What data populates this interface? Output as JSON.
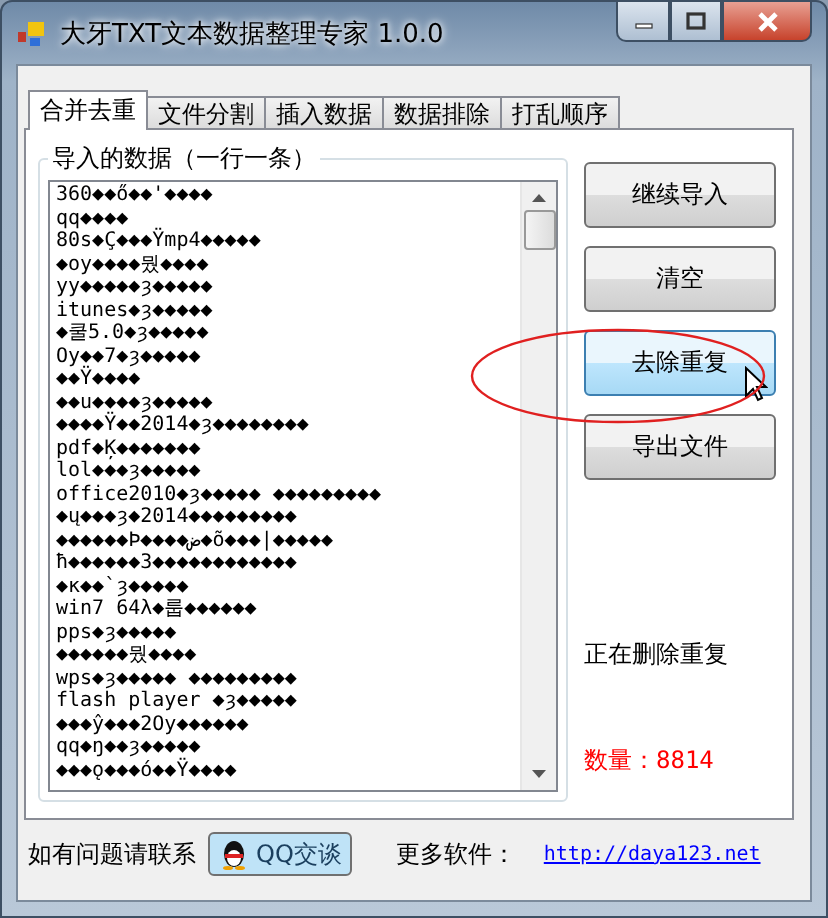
{
  "window": {
    "title": "大牙TXT文本数据整理专家 1.0.0"
  },
  "tabs": [
    {
      "label": "合并去重",
      "selected": true
    },
    {
      "label": "文件分割",
      "selected": false
    },
    {
      "label": "插入数据",
      "selected": false
    },
    {
      "label": "数据排除",
      "selected": false
    },
    {
      "label": "打乱顺序",
      "selected": false
    }
  ],
  "group": {
    "title": "导入的数据（一行一条）",
    "lines": [
      "360◆◆ő◆◆'◆◆◆◆",
      "qq◆◆◆◆",
      "80s◆Ç◆◆◆Ÿmp4◆◆◆◆◆",
      "◆oy◆◆◆◆뭤◆◆◆◆",
      "yy◆◆◆◆◆ȝ◆◆◆◆◆",
      "itunes◆ȝ◆◆◆◆◆",
      "◆쿨5.0◆ȝ◆◆◆◆◆",
      "Oy◆◆7◆ȝ◆◆◆◆◆",
      "◆◆Ÿ◆◆◆◆",
      "◆◆u◆◆◆◆ȝ◆◆◆◆◆",
      "◆◆◆◆Ÿ◆◆2014◆ȝ◆◆◆◆◆◆◆◆",
      "pdf◆Ķ◆◆◆◆◆◆◆",
      "lol◆◆◆ȝ◆◆◆◆◆",
      "office2010◆ȝ◆◆◆◆◆ ◆◆◆◆◆◆◆◆◆",
      "◆ų◆◆◆ȝ◆2014◆◆◆◆◆◆◆◆◆",
      "◆◆◆◆◆◆Þ◆◆◆◆ض◆õ◆◆◆|◆◆◆◆◆",
      "ħ◆◆◆◆◆◆3◆◆◆◆◆◆◆◆◆◆◆◆",
      "◆ĸ◆◆`ȝ◆◆◆◆◆",
      "win7 64λ◆룹◆◆◆◆◆◆",
      "pps◆ȝ◆◆◆◆◆",
      "◆◆◆◆◆◆뭤◆◆◆◆",
      "wps◆ȝ◆◆◆◆◆ ◆◆◆◆◆◆◆◆◆",
      "flash player ◆ȝ◆◆◆◆◆",
      "◆◆◆ŷ◆◆◆2Oy◆◆◆◆◆◆",
      "qq◆ŋ◆◆ȝ◆◆◆◆◆",
      "◆◆◆ǫ◆◆◆ó◆◆Ÿ◆◆◆◆"
    ]
  },
  "buttons": [
    {
      "label": "继续导入",
      "hovered": false
    },
    {
      "label": "清空",
      "hovered": false
    },
    {
      "label": "去除重复",
      "hovered": true
    },
    {
      "label": "导出文件",
      "hovered": false
    }
  ],
  "status": "正在删除重复",
  "count": "数量：8814",
  "footer": {
    "contact": "如有问题请联系",
    "qq_button": "QQ交谈",
    "more": "更多软件：",
    "link": "http://daya123.net"
  }
}
